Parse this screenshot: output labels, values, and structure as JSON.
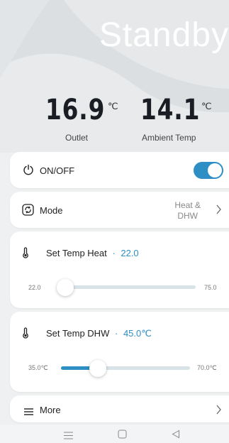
{
  "status": {
    "title": "Standby"
  },
  "readings": [
    {
      "value": "16.9",
      "unit": "℃",
      "label": "Outlet"
    },
    {
      "value": "14.1",
      "unit": "℃",
      "label": "Ambient Temp"
    }
  ],
  "power": {
    "label": "ON/OFF",
    "on": true,
    "icon": "power-icon"
  },
  "mode": {
    "label": "Mode",
    "value_line1": "Heat &",
    "value_line2": "DHW",
    "icon": "mode-icon"
  },
  "heat": {
    "title": "Set Temp Heat",
    "separator": "·",
    "value": "22.0",
    "min_label": "22.0",
    "max_label": "75.0",
    "min": 22.0,
    "max": 75.0,
    "current": 22.0,
    "icon": "thermometer-icon"
  },
  "dhw": {
    "title": "Set Temp DHW",
    "separator": "·",
    "value": "45.0℃",
    "min_label": "35.0℃",
    "max_label": "70.0℃",
    "min": 35.0,
    "max": 70.0,
    "current": 45.0,
    "icon": "thermometer-icon"
  },
  "more": {
    "label": "More",
    "icon": "menu-icon"
  },
  "colors": {
    "accent": "#2e8fc4",
    "track": "#d8e3e8",
    "background": "#eef0f1"
  },
  "navbar": {
    "icons": [
      "menu-icon",
      "home-square-icon",
      "back-triangle-icon"
    ]
  }
}
